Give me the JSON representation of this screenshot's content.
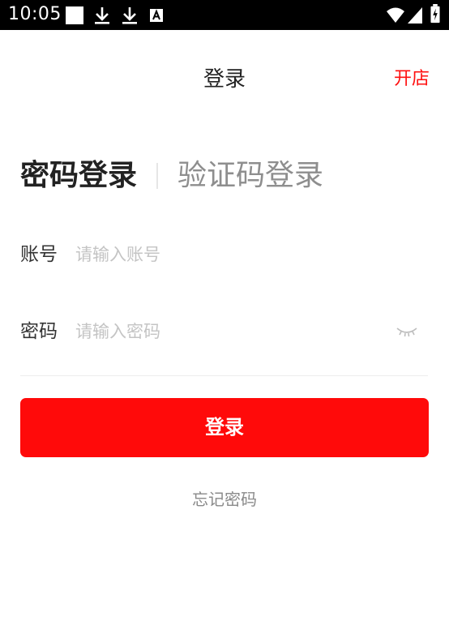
{
  "status_bar": {
    "time": "10:05",
    "icons": [
      "square-notification-icon",
      "download-icon",
      "download-icon",
      "font-a-icon",
      "wifi-icon",
      "signal-icon",
      "battery-icon"
    ]
  },
  "header": {
    "title": "登录",
    "right_action": "开店",
    "accent_color": "#ff1111"
  },
  "tabs": [
    {
      "label": "密码登录",
      "active": true
    },
    {
      "label": "验证码登录",
      "active": false
    }
  ],
  "form": {
    "account_label": "账号",
    "account_placeholder": "请输入账号",
    "account_value": "",
    "password_label": "密码",
    "password_placeholder": "请输入密码",
    "password_value": "",
    "password_visibility_icon": "eye-closed-icon"
  },
  "login_button": {
    "label": "登录",
    "color": "#ff0a0a"
  },
  "forgot_password": "忘记密码"
}
